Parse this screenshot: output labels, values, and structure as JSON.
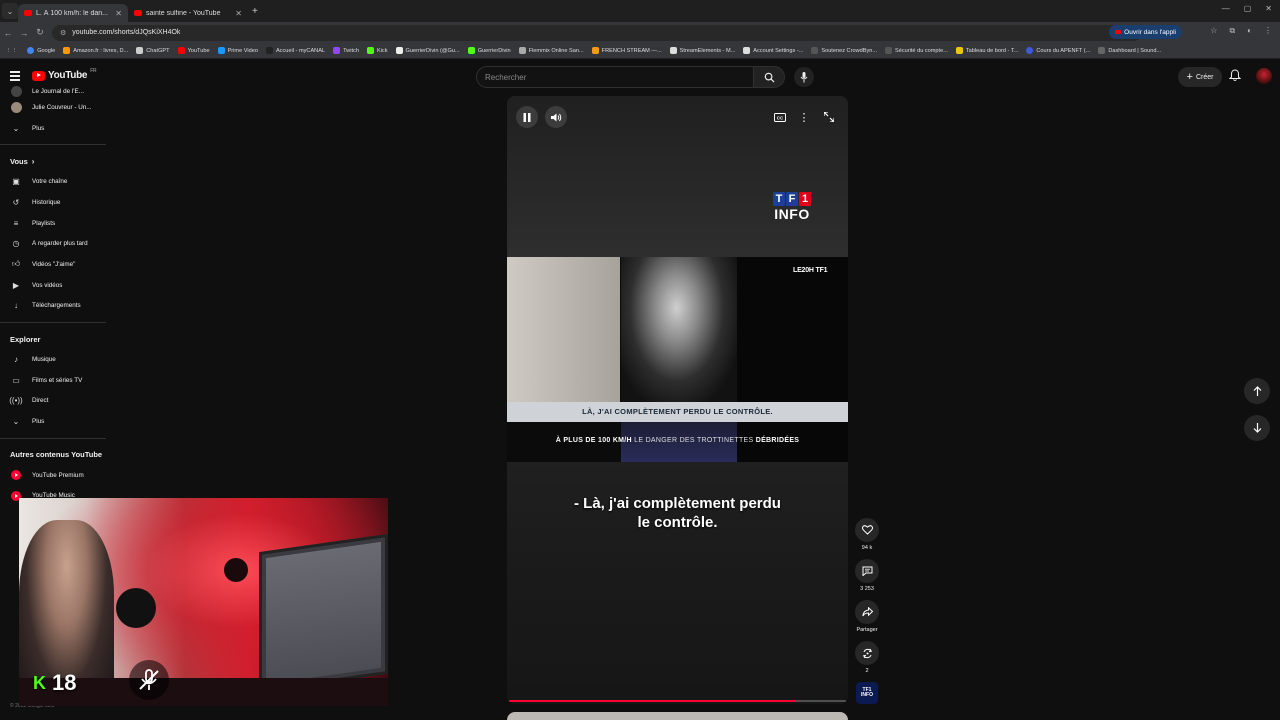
{
  "browser": {
    "tabs": [
      {
        "title": "L. À 100 km/h: le dan...",
        "active": true
      },
      {
        "title": "sainte sulfine - YouTube",
        "active": false
      }
    ],
    "url": "youtube.com/shorts/dJQsKiXH4Ok",
    "open_app_label": "Ouvrir dans l'appli",
    "bookmarks": [
      "Google",
      "Amazon.fr : livres, D...",
      "ChatGPT",
      "YouTube",
      "Prime Video",
      "Accueil - myCANAL",
      "Twitch",
      "Kick",
      "GuerrierDivin (@Gu...",
      "GuerrierDivin",
      "Flemmix Online San...",
      "FRENCH STREAM —...",
      "StreamElements - M...",
      "Account Settings -...",
      "Soutenez CrowdByn...",
      "Sécurité du compte...",
      "Tableau de bord - T...",
      "Cours du APENFT (...",
      "Dashboard | Sound..."
    ]
  },
  "header": {
    "logo_text": "YouTube",
    "logo_region": "FR",
    "search_placeholder": "Rechercher",
    "create_label": "Créer"
  },
  "sidebar": {
    "subscriptions": [
      {
        "label": "Le Journal de l'E..."
      },
      {
        "label": "Julie Couvreur - Un..."
      }
    ],
    "more_label": "Plus",
    "you_heading": "Vous",
    "you_items": [
      {
        "label": "Votre chaîne",
        "icon": "channel-icon"
      },
      {
        "label": "Historique",
        "icon": "history-icon"
      },
      {
        "label": "Playlists",
        "icon": "playlists-icon"
      },
      {
        "label": "À regarder plus tard",
        "icon": "watch-later-icon"
      },
      {
        "label": "Vidéos \"J'aime\"",
        "icon": "like-icon"
      },
      {
        "label": "Vos vidéos",
        "icon": "your-videos-icon"
      },
      {
        "label": "Téléchargements",
        "icon": "download-icon"
      }
    ],
    "explore_heading": "Explorer",
    "explore_items": [
      {
        "label": "Musique",
        "icon": "music-icon"
      },
      {
        "label": "Films et séries TV",
        "icon": "movies-icon"
      },
      {
        "label": "Direct",
        "icon": "live-icon"
      },
      {
        "label": "Plus",
        "icon": "chevron-down-icon"
      }
    ],
    "other_heading": "Autres contenus YouTube",
    "other_items": [
      {
        "label": "YouTube Premium"
      },
      {
        "label": "YouTube Music"
      }
    ],
    "copyright": "© 2025 Google LLC"
  },
  "webcam": {
    "platform": "kick",
    "viewer_count": "18",
    "mic_muted": true
  },
  "short": {
    "brand_top": "TF1",
    "brand_bottom": "INFO",
    "clip_tag": "LE20H TF1",
    "clip_subtitle": "LÀ, J'AI COMPLÈTEMENT PERDU LE CONTRÔLE.",
    "clip_title_a": "À PLUS DE 100 KM/H",
    "clip_title_b": "LE DANGER DES TROTTINETTES",
    "clip_title_c": "DÉBRIDÉES",
    "caption_line1": "- Là, j'ai complètement perdu",
    "caption_line2": "le contrôle.",
    "progress": 0.85,
    "channel_thumb_top": "TF1",
    "channel_thumb_bottom": "INFO"
  },
  "actions": {
    "likes": "94 k",
    "comments": "3 253",
    "share_label": "Partager",
    "remix_count": "2"
  },
  "colors": {
    "accent": "#ff0033",
    "background": "#0f0f0f",
    "kick_green": "#53fc18"
  }
}
